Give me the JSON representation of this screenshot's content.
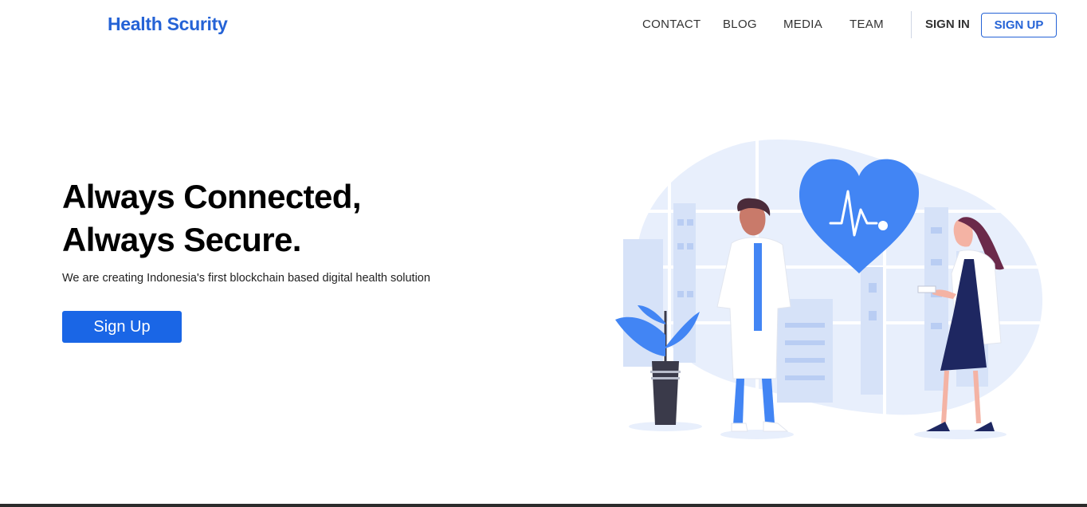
{
  "brand": {
    "name": "Health Scurity"
  },
  "nav": {
    "links": [
      "CONTACT",
      "BLOG",
      "MEDIA",
      "TEAM"
    ],
    "signin_label": "SIGN IN",
    "signup_label": "SIGN UP"
  },
  "hero": {
    "title_line1": "Always Connected,",
    "title_line2": "Always Secure.",
    "subtitle": "We are creating Indonesia's first blockchain based digital health solution",
    "cta_label": "Sign Up"
  },
  "illustration": {
    "subject": "doctors-heart-illustration",
    "accent": "#4285f4",
    "backdrop": "#e8effc"
  },
  "colors": {
    "brand": "#2563d6",
    "primary_button": "#1a66e6",
    "text": "#111111"
  }
}
